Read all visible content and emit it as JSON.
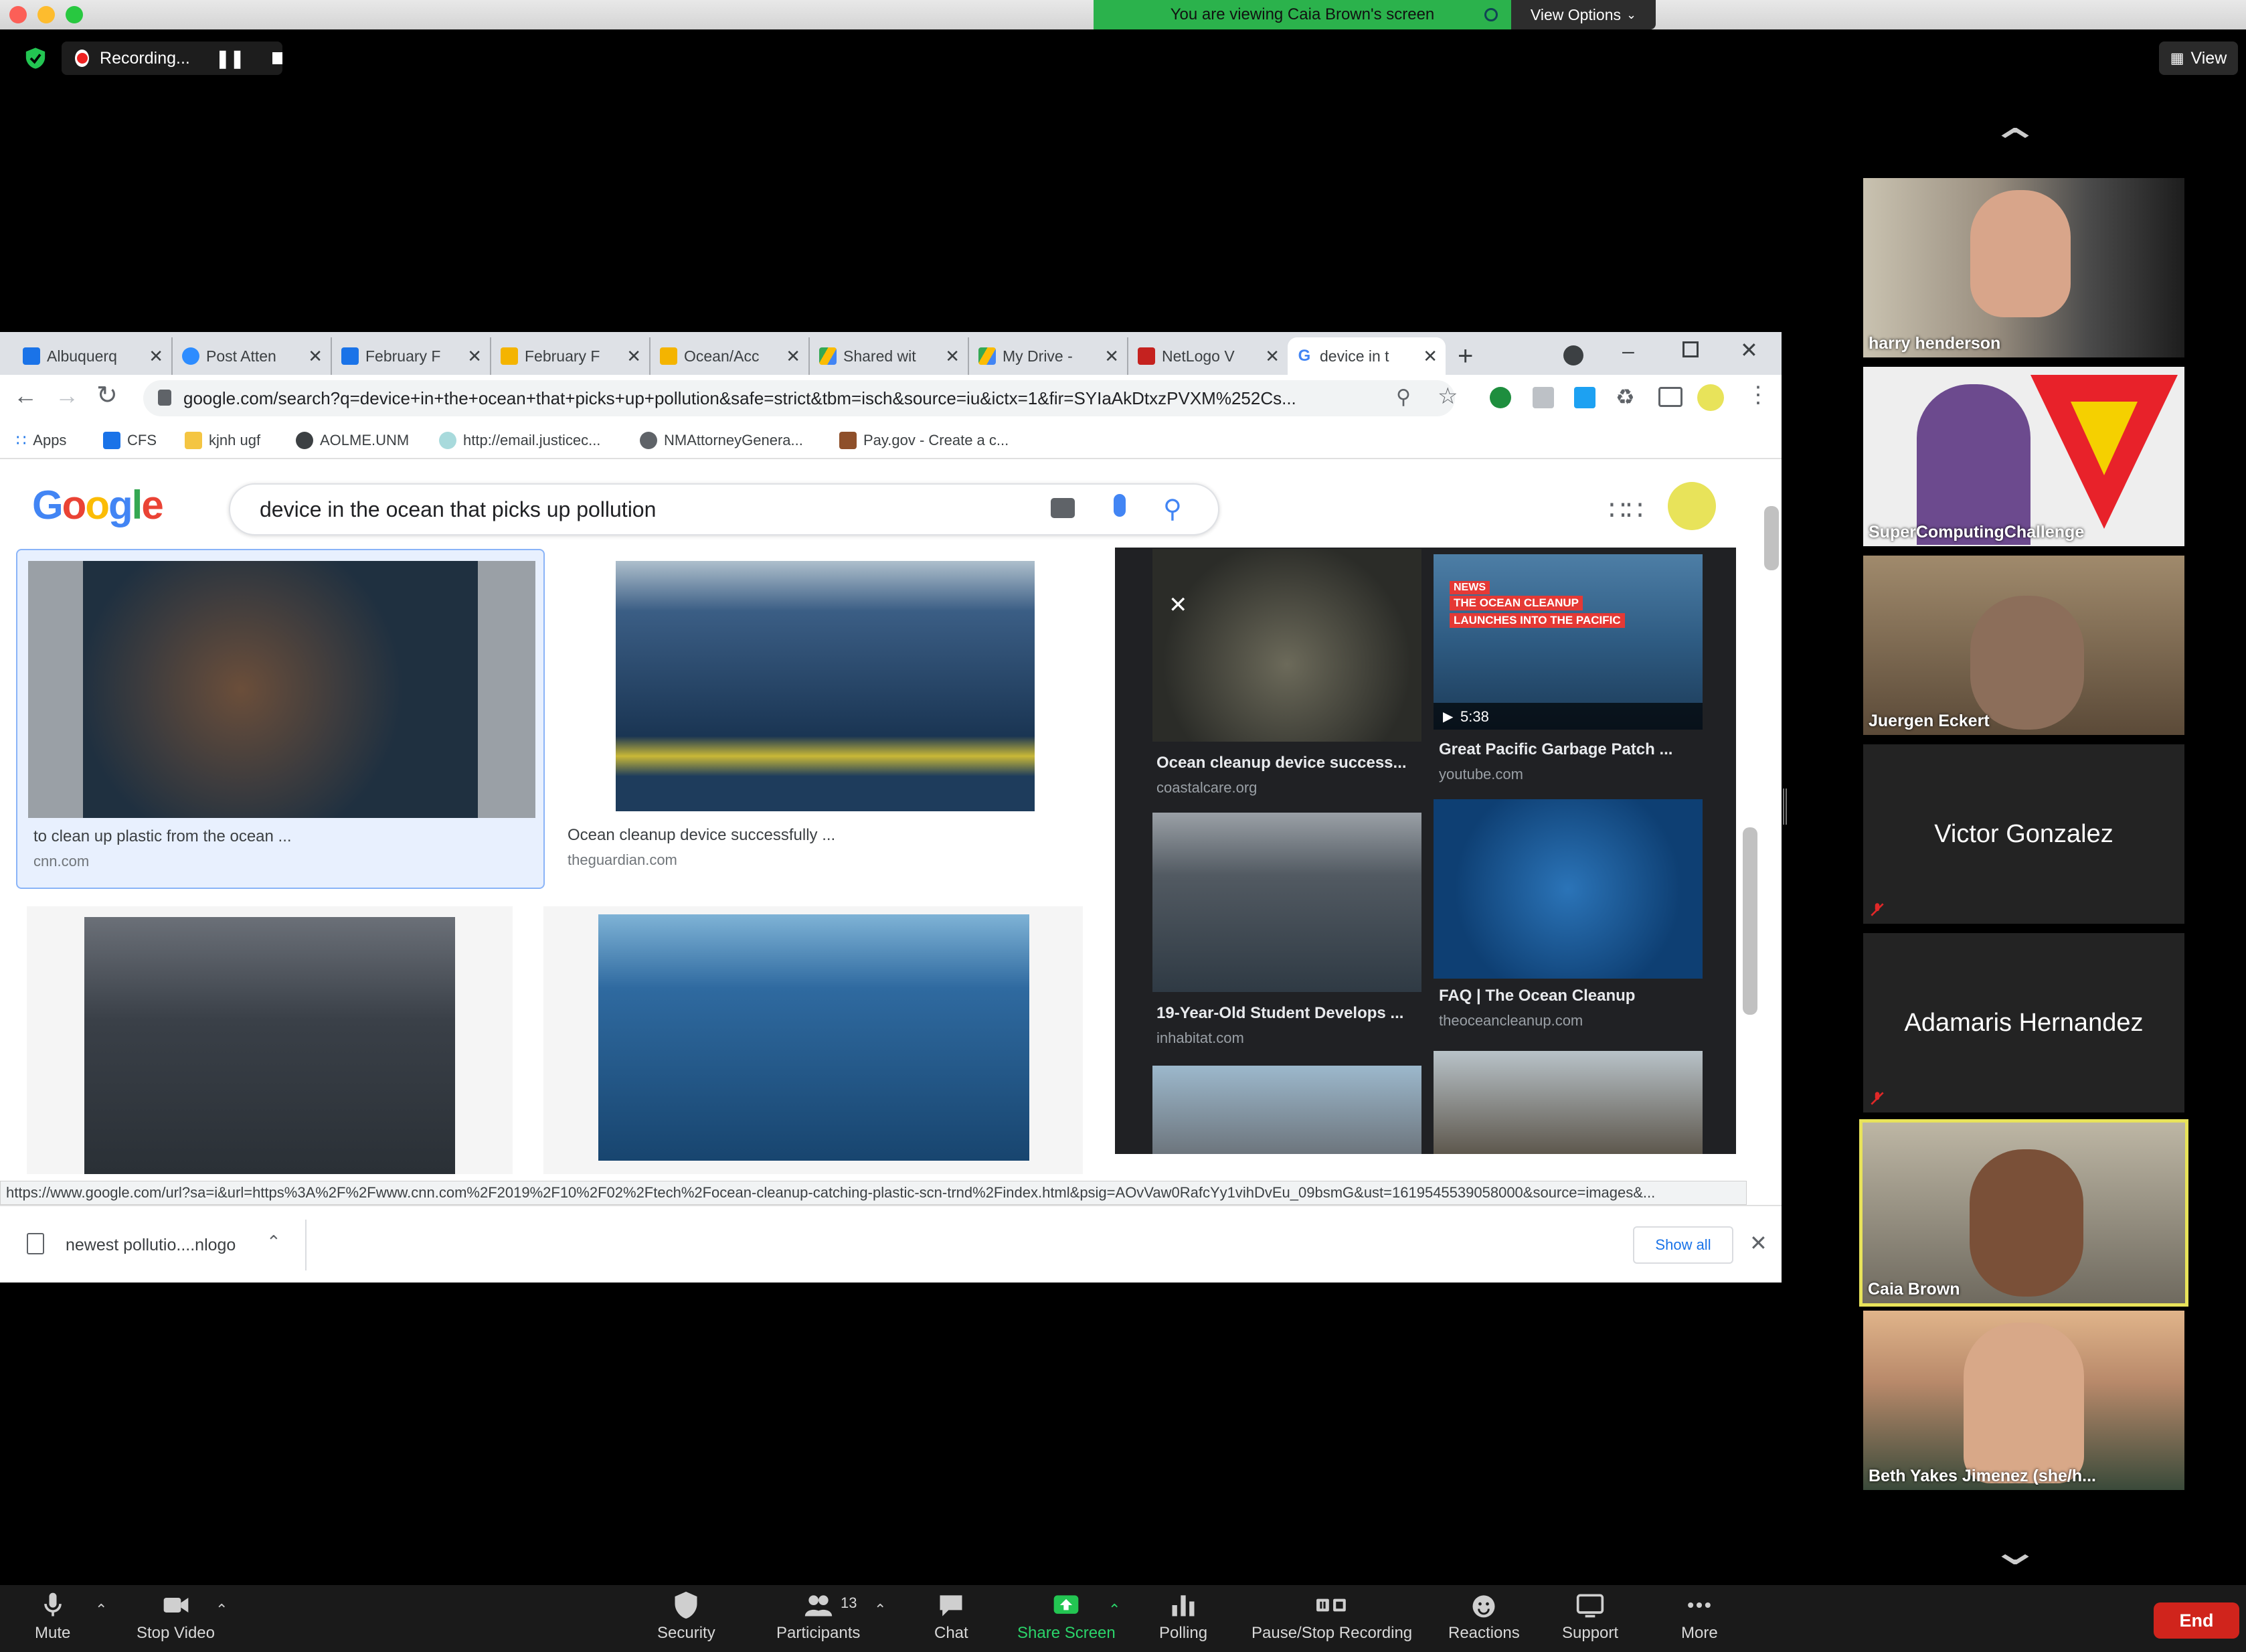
{
  "zoom": {
    "viewing_banner": "You are viewing Caia Brown's screen",
    "view_options": "View Options",
    "recording_label": "Recording...",
    "view_label": "View"
  },
  "browser": {
    "tabs": [
      {
        "label": "Albuquerq",
        "icon": "calendar-icon",
        "color": "#1a73e8"
      },
      {
        "label": "Post Atten",
        "icon": "zoom-icon",
        "color": "#2d8cff"
      },
      {
        "label": "February F",
        "icon": "forms-icon",
        "color": "#1a73e8"
      },
      {
        "label": "February F",
        "icon": "classroom-icon",
        "color": "#f4b400"
      },
      {
        "label": "Ocean/Acc",
        "icon": "slides-icon",
        "color": "#f4b400"
      },
      {
        "label": "Shared wit",
        "icon": "drive-icon",
        "color": "#34a853"
      },
      {
        "label": "My Drive -",
        "icon": "drive-icon",
        "color": "#34a853"
      },
      {
        "label": "NetLogo V",
        "icon": "netlogo-icon",
        "color": "#c5221f"
      },
      {
        "label": "device in t",
        "icon": "google-icon",
        "color": "#4285f4"
      }
    ],
    "url": "google.com/search?q=device+in+the+ocean+that+picks+up+pollution&safe=strict&tbm=isch&source=iu&ictx=1&fir=SYIaAkDtxzPVXM%252Cs...",
    "bookmarks": [
      "Apps",
      "CFS",
      "kjnh ugf",
      "AOLME.UNM",
      "http://email.justicec...",
      "NMAttorneyGenera...",
      "Pay.gov - Create a c..."
    ],
    "search_query": "device in the ocean that picks up pollution",
    "logo_text": "Google",
    "results": [
      {
        "title": "to clean up plastic from the ocean ...",
        "source": "cnn.com"
      },
      {
        "title": "Ocean cleanup device successfully ...",
        "source": "theguardian.com"
      }
    ],
    "panel": [
      {
        "title": "Ocean cleanup device success...",
        "source": "coastalcare.org"
      },
      {
        "title": "Great Pacific Garbage Patch ...",
        "source": "youtube.com",
        "duration": "5:38",
        "overlay_badge": "NEWS",
        "overlay_line1": "THE OCEAN CLEANUP",
        "overlay_line2": "LAUNCHES INTO THE PACIFIC"
      },
      {
        "title": "19-Year-Old Student Develops ...",
        "source": "inhabitat.com"
      },
      {
        "title": "FAQ | The Ocean Cleanup",
        "source": "theoceancleanup.com"
      }
    ],
    "status_url": "https://www.google.com/url?sa=i&url=https%3A%2F%2Fwww.cnn.com%2F2019%2F10%2F02%2Ftech%2Focean-cleanup-catching-plastic-scn-trnd%2Findex.html&psig=AOvVaw0RafcYy1vihDvEu_09bsmG&ust=1619545539058000&source=images&...",
    "download_name": "newest pollutio....nlogo",
    "show_all": "Show all"
  },
  "participants": [
    {
      "name": "harry henderson",
      "video": true
    },
    {
      "name": "SuperComputingChallenge",
      "video": true
    },
    {
      "name": "Juergen Eckert",
      "video": true
    },
    {
      "name": "Victor Gonzalez",
      "video": false,
      "muted": true
    },
    {
      "name": "Adamaris Hernandez",
      "video": false,
      "muted": true
    },
    {
      "name": "Caia Brown",
      "video": true,
      "active_speaker": true
    },
    {
      "name": "Beth Yakes Jimenez (she/h...",
      "video": true
    }
  ],
  "controls": {
    "mute": "Mute",
    "stop_video": "Stop Video",
    "security": "Security",
    "participants": "Participants",
    "participant_count": "13",
    "chat": "Chat",
    "share_screen": "Share Screen",
    "polling": "Polling",
    "pause_stop_recording": "Pause/Stop Recording",
    "reactions": "Reactions",
    "support": "Support",
    "more": "More",
    "end": "End"
  },
  "colors": {
    "zoom_green": "#2bb24c",
    "active_speaker": "#e8e35a",
    "end_red": "#d0241c",
    "link_blue": "#1a73e8"
  }
}
